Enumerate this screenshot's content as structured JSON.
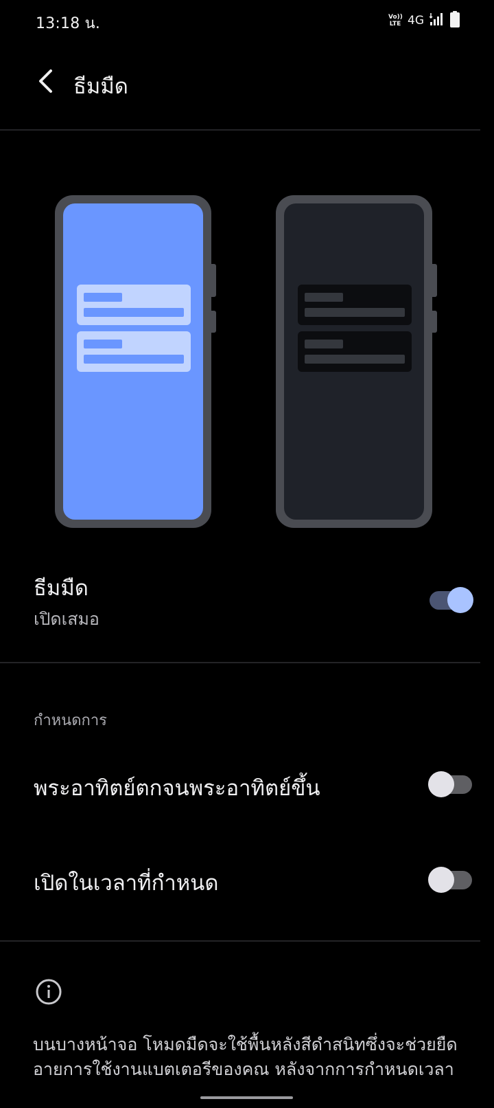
{
  "status_bar": {
    "time": "13:18 น.",
    "volte_top": "Vo))",
    "volte_bottom": "LTE",
    "network": "4G"
  },
  "header": {
    "title": "ธีมมืด"
  },
  "dark_theme": {
    "title": "ธีมมืด",
    "status": "เปิดเสมอ",
    "enabled": true
  },
  "schedule": {
    "section_label": "กำหนดการ",
    "options": [
      {
        "label": "พระอาทิตย์ตกจนพระอาทิตย์ขึ้น",
        "enabled": false
      },
      {
        "label": "เปิดในเวลาที่กำหนด",
        "enabled": false
      }
    ]
  },
  "info": {
    "text": "บนบางหน้าจอ โหมดมืดจะใช้พื้นหลังสีดำสนิทซึ่งจะช่วยยืดอายุการใช้งานแบตเตอรีของคุณ หลังจากการกำหนดเวลาโหมดมืดจะไม่เปิดจนกว่าหน้าจอจะปิดอยู่ จะมีผล"
  },
  "colors": {
    "accent": "#a9c3ff",
    "light_preview": "#6a96ff",
    "dark_preview": "#1f2229"
  }
}
